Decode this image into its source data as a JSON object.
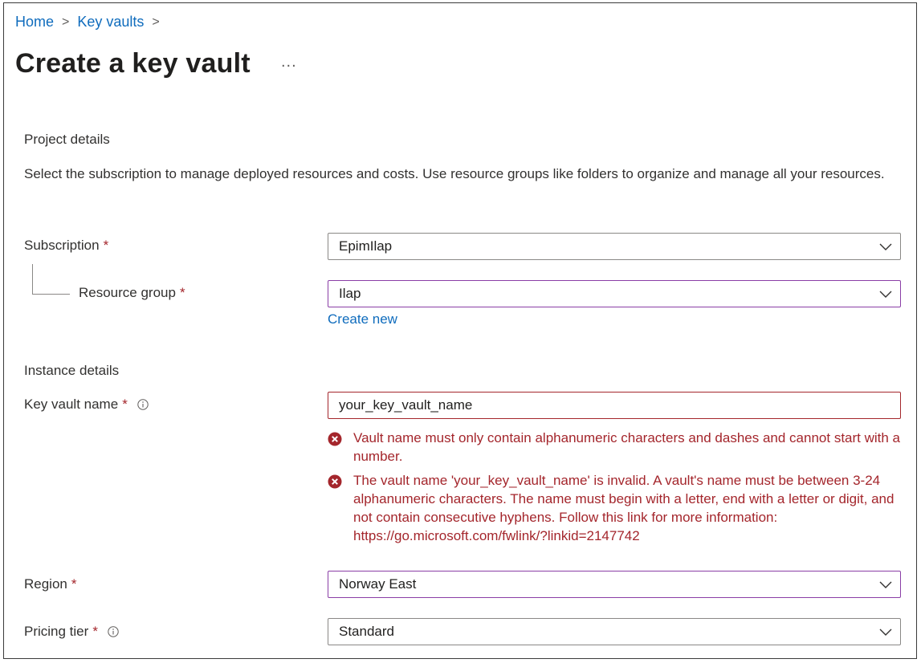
{
  "breadcrumb": {
    "home": "Home",
    "key_vaults": "Key vaults",
    "separator": ">"
  },
  "page": {
    "title": "Create a key vault",
    "more": "..."
  },
  "project": {
    "heading": "Project details",
    "description": "Select the subscription to manage deployed resources and costs. Use resource groups like folders to organize and manage all your resources."
  },
  "subscription": {
    "label": "Subscription",
    "required": "*",
    "value": "EpimIlap"
  },
  "resource_group": {
    "label": "Resource group",
    "required": "*",
    "value": "Ilap",
    "create_new": "Create new"
  },
  "instance": {
    "heading": "Instance details"
  },
  "key_vault_name": {
    "label": "Key vault name",
    "required": "*",
    "value": "your_key_vault_name",
    "errors": [
      "Vault name must only contain alphanumeric characters and dashes and cannot start with a number.",
      "The vault name 'your_key_vault_name' is invalid. A vault's name must be between 3-24 alphanumeric characters. The name must begin with a letter, end with a letter or digit, and not contain consecutive hyphens. Follow this link for more information: https://go.microsoft.com/fwlink/?linkid=2147742"
    ]
  },
  "region": {
    "label": "Region",
    "required": "*",
    "value": "Norway East"
  },
  "pricing_tier": {
    "label": "Pricing tier",
    "required": "*",
    "value": "Standard"
  },
  "colors": {
    "link": "#0f6cbd",
    "error": "#a4262c",
    "required": "#a4262c",
    "focus_border": "#8a3ea6",
    "text": "#323130"
  },
  "icons": {
    "info": "info-icon",
    "chevron": "chevron-down-icon",
    "error": "error-circle-icon"
  }
}
